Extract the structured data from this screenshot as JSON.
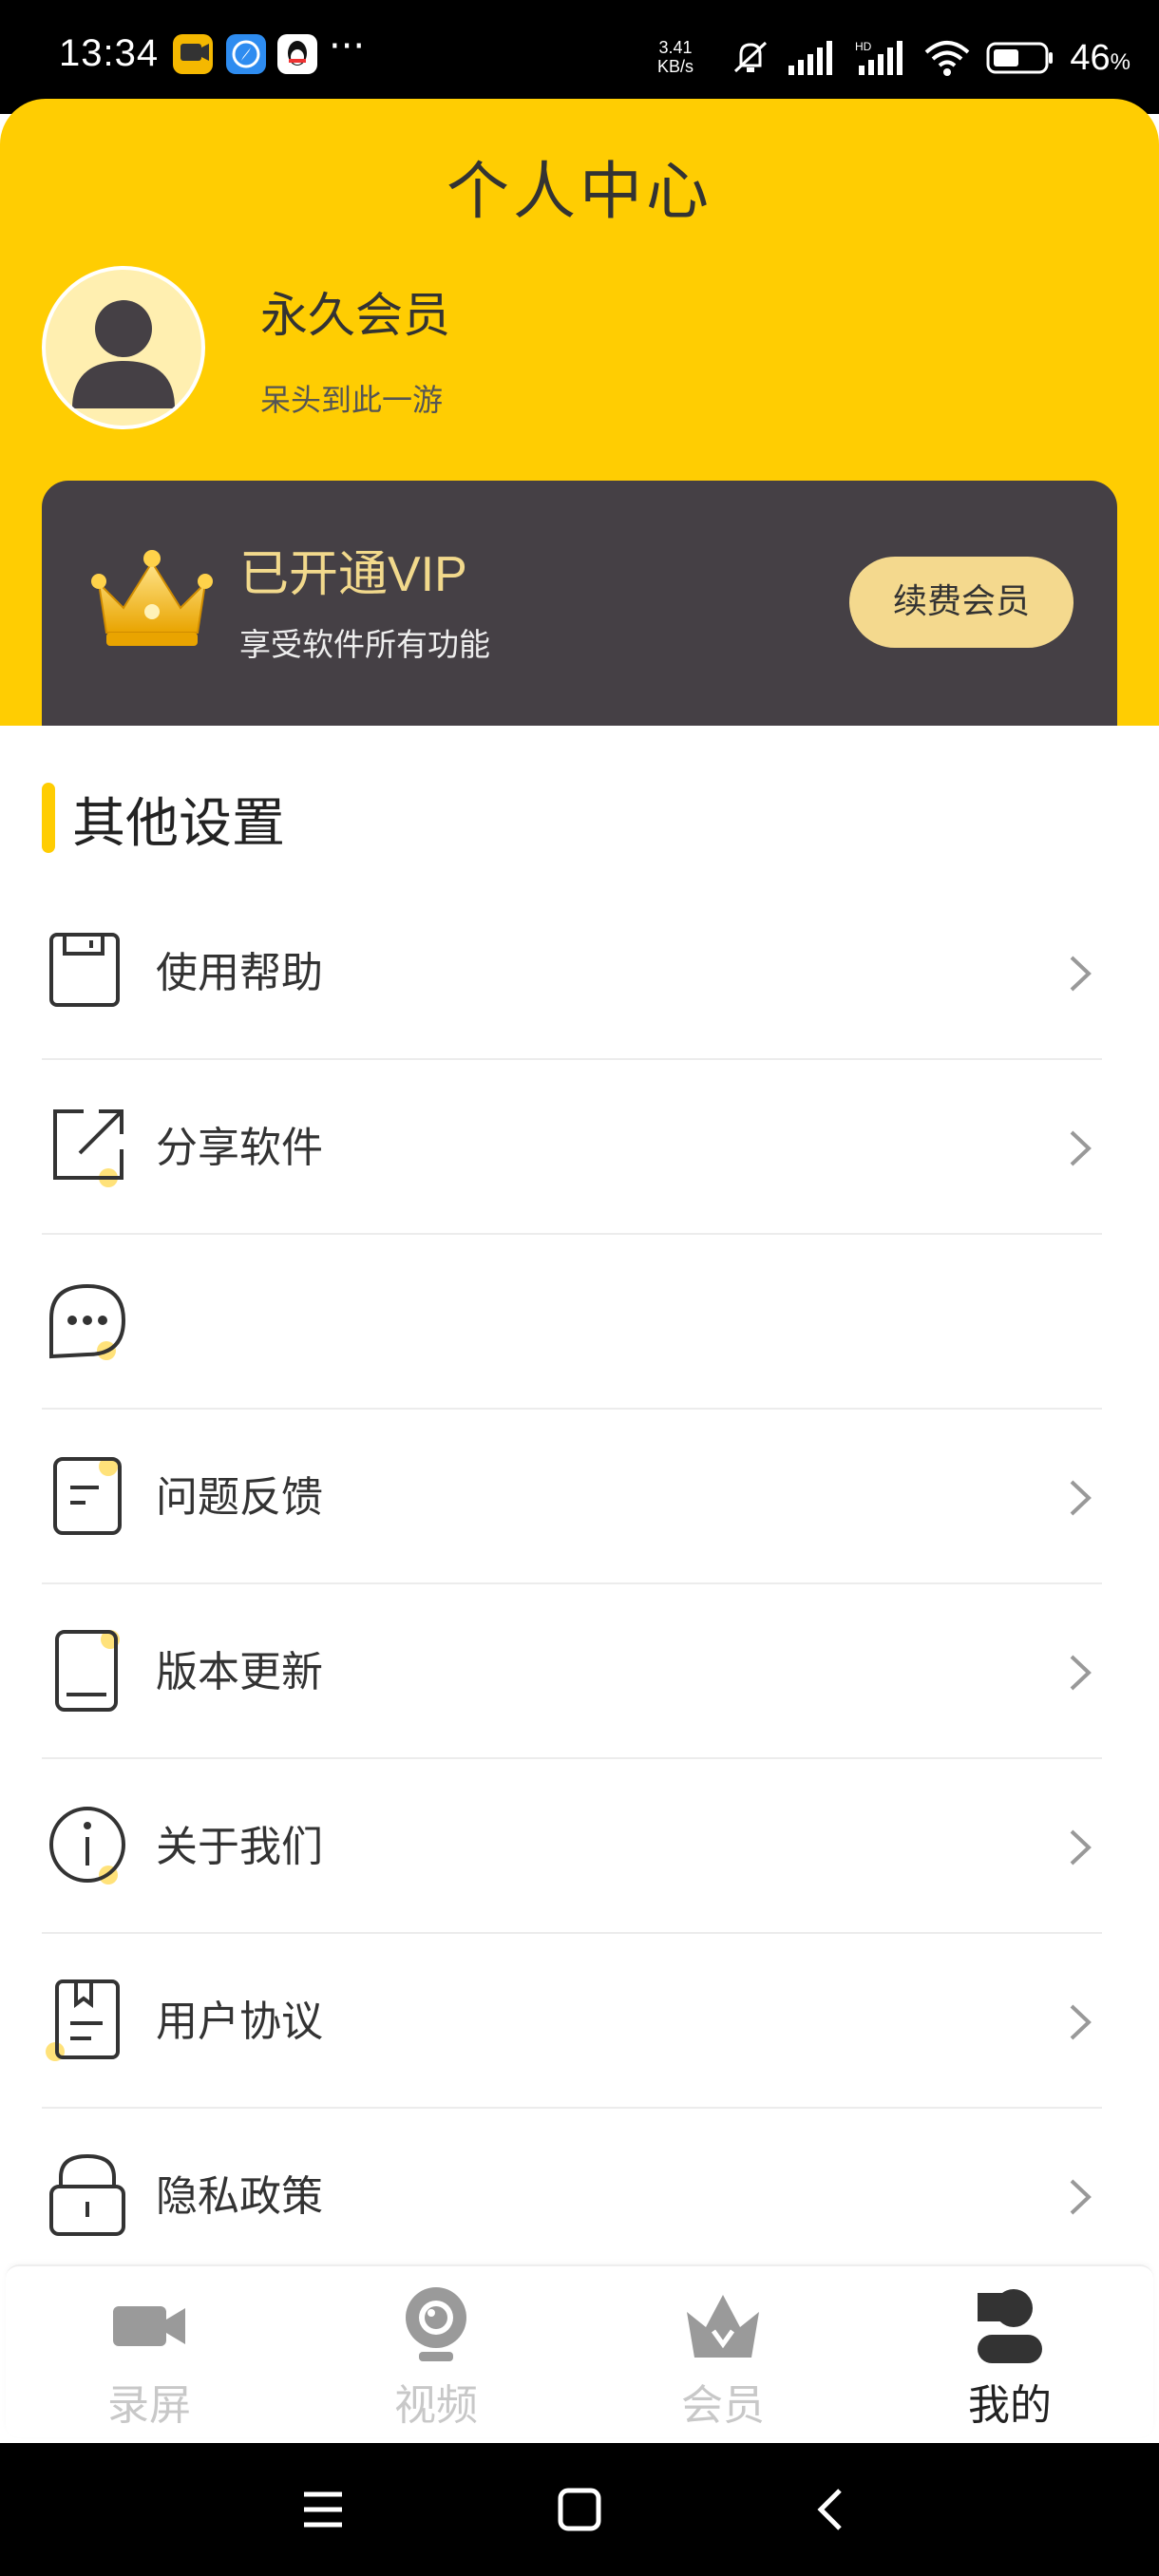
{
  "status_bar": {
    "time": "13:34",
    "more": "···",
    "net_speed_value": "3.41",
    "net_speed_unit": "KB/s",
    "battery": "46",
    "battery_unit": "%"
  },
  "header": {
    "title": "个人中心",
    "user_name": "永久会员",
    "user_subtitle": "呆头到此一游"
  },
  "vip": {
    "title": "已开通VIP",
    "subtitle": "享受软件所有功能",
    "renew_label": "续费会员"
  },
  "settings": {
    "section_title": "其他设置",
    "items": [
      {
        "label": "使用帮助",
        "icon": "help-icon",
        "chevron": true
      },
      {
        "label": "分享软件",
        "icon": "share-icon",
        "chevron": true
      },
      {
        "label": "",
        "icon": "message-icon",
        "chevron": false
      },
      {
        "label": "问题反馈",
        "icon": "feedback-icon",
        "chevron": true
      },
      {
        "label": "版本更新",
        "icon": "update-icon",
        "chevron": true
      },
      {
        "label": "关于我们",
        "icon": "info-icon",
        "chevron": true
      },
      {
        "label": "用户协议",
        "icon": "agreement-icon",
        "chevron": true
      },
      {
        "label": "隐私政策",
        "icon": "privacy-icon",
        "chevron": true
      }
    ]
  },
  "tabs": [
    {
      "label": "录屏",
      "icon": "record-icon",
      "active": false
    },
    {
      "label": "视频",
      "icon": "video-icon",
      "active": false
    },
    {
      "label": "会员",
      "icon": "member-icon",
      "active": false
    },
    {
      "label": "我的",
      "icon": "profile-icon",
      "active": true
    }
  ],
  "colors": {
    "accent": "#FFCD02",
    "vip_card": "#454045",
    "vip_gold": "#F4D98E",
    "text_dark": "#333333",
    "tab_inactive": "#c8c8c8"
  }
}
